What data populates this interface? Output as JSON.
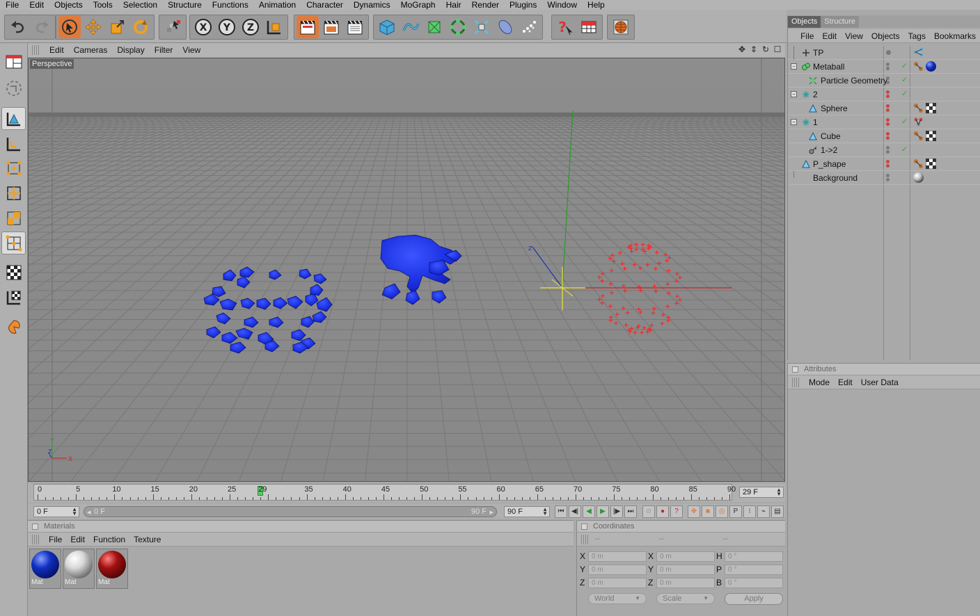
{
  "menubar": [
    "File",
    "Edit",
    "Objects",
    "Tools",
    "Selection",
    "Structure",
    "Functions",
    "Animation",
    "Character",
    "Dynamics",
    "MoGraph",
    "Hair",
    "Render",
    "Plugins",
    "Window",
    "Help"
  ],
  "viewport": {
    "menu": [
      "Edit",
      "Cameras",
      "Display",
      "Filter",
      "View"
    ],
    "label": "Perspective",
    "axis_x": "X",
    "axis_y": "Y",
    "axis_z": "Z"
  },
  "timeline": {
    "ticks": [
      "0",
      "5",
      "10",
      "15",
      "20",
      "25",
      "29",
      "35",
      "40",
      "45",
      "50",
      "55",
      "60",
      "65",
      "70",
      "75",
      "80",
      "85",
      "90"
    ],
    "current_frame": "29 F",
    "current_frame_value": 29,
    "max_frame": 90
  },
  "transport": {
    "start_field": "0 F",
    "range_start": "0 F",
    "range_end": "90 F",
    "end_field": "90 F"
  },
  "materials": {
    "title": "Materials",
    "menu": [
      "File",
      "Edit",
      "Function",
      "Texture"
    ],
    "items": [
      {
        "label": "Mat",
        "color": "#1030c0"
      },
      {
        "label": "Mat",
        "color": "#e8e8e8"
      },
      {
        "label": "Mat",
        "color": "#a01010"
      }
    ]
  },
  "coordinates": {
    "title": "Coordinates",
    "col_headers": [
      "--",
      "--",
      "--"
    ],
    "rows": [
      {
        "a": "X",
        "av": "0 m",
        "b": "X",
        "bv": "0 m",
        "c": "H",
        "cv": "0 °"
      },
      {
        "a": "Y",
        "av": "0 m",
        "b": "Y",
        "bv": "0 m",
        "c": "P",
        "cv": "0 °"
      },
      {
        "a": "Z",
        "av": "0 m",
        "b": "Z",
        "bv": "0 m",
        "c": "B",
        "cv": "0 °"
      }
    ],
    "mode1": "World",
    "mode2": "Scale",
    "apply": "Apply"
  },
  "objects": {
    "tabs": [
      "Objects",
      "Structure"
    ],
    "menu": [
      "File",
      "Edit",
      "View",
      "Objects",
      "Tags",
      "Bookmarks"
    ],
    "rows": [
      {
        "name": "TP",
        "indent": 0
      },
      {
        "name": "Metaball",
        "indent": 0
      },
      {
        "name": "Particle Geometry",
        "indent": 1
      },
      {
        "name": "2",
        "indent": 0
      },
      {
        "name": "Sphere",
        "indent": 1
      },
      {
        "name": "1",
        "indent": 0
      },
      {
        "name": "Cube",
        "indent": 1
      },
      {
        "name": "1->2",
        "indent": 1
      },
      {
        "name": "P_shape",
        "indent": 0
      },
      {
        "name": "Background",
        "indent": 0
      }
    ]
  },
  "attributes": {
    "title": "Attributes",
    "menu": [
      "Mode",
      "Edit",
      "User Data"
    ]
  },
  "colors": {
    "accent": "#e07a3a",
    "metaball_blue": "#1a2ee0",
    "particle_red": "#ff2020"
  }
}
